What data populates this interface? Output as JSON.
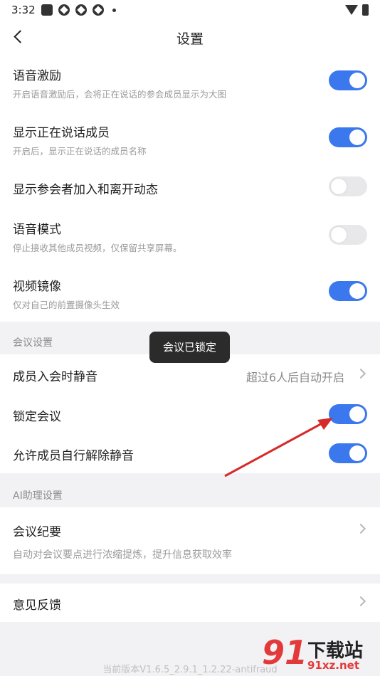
{
  "status_bar": {
    "time": "3:32"
  },
  "header": {
    "title": "设置"
  },
  "settings": [
    {
      "title": "语音激励",
      "subtitle": "开启语音激励后，会将正在说话的参会成员显示为大图",
      "toggle": true
    },
    {
      "title": "显示正在说话成员",
      "subtitle": "开启后，显示正在说话的成员名称",
      "toggle": true
    },
    {
      "title": "显示参会者加入和离开动态",
      "subtitle": "",
      "toggle": false
    },
    {
      "title": "语音模式",
      "subtitle": "停止接收其他成员视频，仅保留共享屏幕。",
      "toggle": false
    },
    {
      "title": "视频镜像",
      "subtitle": "仅对自己的前置摄像头生效",
      "toggle": true
    }
  ],
  "meeting_section": {
    "header": "会议设置",
    "mute_on_join": {
      "title": "成员入会时静音",
      "value": "超过6人后自动开启"
    },
    "lock_meeting": {
      "title": "锁定会议",
      "toggle": true
    },
    "allow_unmute": {
      "title": "允许成员自行解除静音",
      "toggle": true
    }
  },
  "toast": {
    "text": "会议已锁定"
  },
  "ai_section": {
    "header": "AI助理设置",
    "summary": {
      "title": "会议纪要",
      "subtitle": "自动对会议要点进行浓缩提炼，提升信息获取效率"
    }
  },
  "feedback": {
    "title": "意见反馈"
  },
  "footer": {
    "version": "当前版本V1.6.5_2.9.1_1.2.22-antifraud"
  },
  "watermark": {
    "brand": "下载站",
    "domain": "91xz.net",
    "logo_number": "91"
  },
  "colors": {
    "toggle_on": "#3b78ee",
    "toggle_off": "#e8e8ea",
    "annotation_arrow": "#d62b2b"
  }
}
